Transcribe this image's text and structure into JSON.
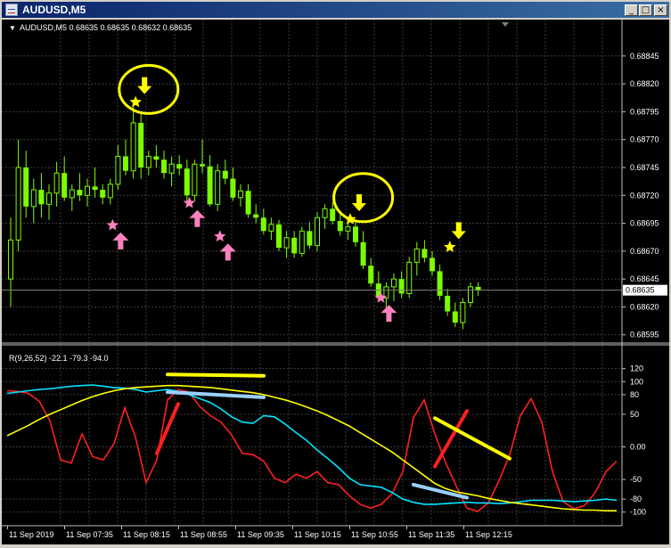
{
  "window": {
    "title": "AUDUSD,M5",
    "buttons": {
      "minimize": "_",
      "restore": "□",
      "close": "×"
    }
  },
  "colors": {
    "background": "#000000",
    "grid": "#3c3c3c",
    "candle": "#7cfc00",
    "fast_line": "#ff2020",
    "mid_line": "#00e5ff",
    "slow_line": "#ffff00",
    "sell_arrow": "#ffff00",
    "buy_arrow": "#ff80c0",
    "annotation_yellow": "#ffff00",
    "annotation_red": "#ff2020",
    "annotation_lightblue": "#9ad0ff"
  },
  "chart_data": [
    {
      "type": "candlestick",
      "symbol": "AUDUSD,M5",
      "header": "AUDUSD,M5  0.68635 0.68635 0.68632 0.68635",
      "y_ticks": [
        "0.68845",
        "0.68820",
        "0.68795",
        "0.68770",
        "0.68745",
        "0.68720",
        "0.68695",
        "0.68670",
        "0.68645",
        "0.68620",
        "0.68595"
      ],
      "ylim": [
        0.6859,
        0.6886
      ],
      "current_price": "0.68635",
      "grid": true,
      "candles": [
        [
          0.68645,
          0.687,
          0.6862,
          0.6868
        ],
        [
          0.6868,
          0.6877,
          0.6867,
          0.68745
        ],
        [
          0.68745,
          0.6876,
          0.687,
          0.6871
        ],
        [
          0.6871,
          0.68735,
          0.68695,
          0.68725
        ],
        [
          0.68725,
          0.6874,
          0.687,
          0.68712
        ],
        [
          0.68712,
          0.6873,
          0.68698,
          0.68722
        ],
        [
          0.68722,
          0.6875,
          0.6871,
          0.6874
        ],
        [
          0.6874,
          0.68755,
          0.68715,
          0.68718
        ],
        [
          0.68718,
          0.6873,
          0.68706,
          0.68725
        ],
        [
          0.68725,
          0.6874,
          0.68715,
          0.6872
        ],
        [
          0.6872,
          0.68735,
          0.6871,
          0.68728
        ],
        [
          0.68728,
          0.68745,
          0.68718,
          0.68725
        ],
        [
          0.68725,
          0.6873,
          0.68712,
          0.68718
        ],
        [
          0.68718,
          0.68735,
          0.68712,
          0.6873
        ],
        [
          0.6873,
          0.68765,
          0.68725,
          0.68755
        ],
        [
          0.68755,
          0.6877,
          0.68738,
          0.68742
        ],
        [
          0.68742,
          0.688,
          0.68735,
          0.68785
        ],
        [
          0.68785,
          0.68795,
          0.68735,
          0.68745
        ],
        [
          0.68745,
          0.6876,
          0.68738,
          0.68755
        ],
        [
          0.68755,
          0.68765,
          0.68745,
          0.68752
        ],
        [
          0.68752,
          0.6876,
          0.68735,
          0.6874
        ],
        [
          0.6874,
          0.68755,
          0.68728,
          0.68748
        ],
        [
          0.68748,
          0.68756,
          0.68738,
          0.68744
        ],
        [
          0.68744,
          0.68752,
          0.68715,
          0.6872
        ],
        [
          0.6872,
          0.68752,
          0.68715,
          0.68748
        ],
        [
          0.68748,
          0.6877,
          0.6874,
          0.68746
        ],
        [
          0.68746,
          0.68756,
          0.6871,
          0.68712
        ],
        [
          0.68712,
          0.68748,
          0.68706,
          0.68742
        ],
        [
          0.68742,
          0.68752,
          0.6873,
          0.68735
        ],
        [
          0.68735,
          0.68745,
          0.68715,
          0.68718
        ],
        [
          0.68718,
          0.6873,
          0.6871,
          0.68724
        ],
        [
          0.68724,
          0.6873,
          0.687,
          0.68703
        ],
        [
          0.68703,
          0.68712,
          0.68695,
          0.687
        ],
        [
          0.687,
          0.68708,
          0.68685,
          0.68688
        ],
        [
          0.68688,
          0.687,
          0.6868,
          0.68694
        ],
        [
          0.68694,
          0.68698,
          0.6867,
          0.68673
        ],
        [
          0.68673,
          0.68688,
          0.68664,
          0.68682
        ],
        [
          0.68682,
          0.68688,
          0.68664,
          0.68668
        ],
        [
          0.68668,
          0.68692,
          0.68665,
          0.68688
        ],
        [
          0.68688,
          0.68696,
          0.68672,
          0.68675
        ],
        [
          0.68675,
          0.68705,
          0.6867,
          0.687
        ],
        [
          0.687,
          0.68712,
          0.6869,
          0.68708
        ],
        [
          0.68708,
          0.68714,
          0.68694,
          0.68697
        ],
        [
          0.68697,
          0.68704,
          0.68684,
          0.68688
        ],
        [
          0.68688,
          0.68698,
          0.6868,
          0.68692
        ],
        [
          0.68692,
          0.68698,
          0.68674,
          0.68678
        ],
        [
          0.68678,
          0.68688,
          0.68654,
          0.68657
        ],
        [
          0.68657,
          0.68664,
          0.68638,
          0.68641
        ],
        [
          0.68641,
          0.68652,
          0.68625,
          0.68628
        ],
        [
          0.68628,
          0.68642,
          0.68618,
          0.68638
        ],
        [
          0.68638,
          0.6865,
          0.68625,
          0.68645
        ],
        [
          0.68645,
          0.68652,
          0.68628,
          0.68632
        ],
        [
          0.68632,
          0.68665,
          0.68628,
          0.6866
        ],
        [
          0.6866,
          0.68678,
          0.68648,
          0.68672
        ],
        [
          0.68672,
          0.6868,
          0.6866,
          0.68664
        ],
        [
          0.68664,
          0.6867,
          0.68648,
          0.68652
        ],
        [
          0.68652,
          0.68658,
          0.68626,
          0.6863
        ],
        [
          0.6863,
          0.68636,
          0.68612,
          0.68616
        ],
        [
          0.68616,
          0.68624,
          0.68602,
          0.68606
        ],
        [
          0.68606,
          0.68628,
          0.686,
          0.68624
        ],
        [
          0.68624,
          0.68642,
          0.6862,
          0.68638
        ],
        [
          0.68638,
          0.68642,
          0.6863,
          0.68635
        ]
      ],
      "x_ticks": [
        "11 Sep 2019",
        "11 Sep 07:35",
        "11 Sep 08:15",
        "11 Sep 08:55",
        "11 Sep 09:35",
        "11 Sep 10:15",
        "11 Sep 10:55",
        "11 Sep 11:35",
        "11 Sep 12:15"
      ],
      "sell_signals": [
        [
          17,
          0.6881
        ],
        [
          45,
          0.68705
        ],
        [
          58,
          0.6868
        ]
      ],
      "buy_signals": [
        [
          14,
          0.6869
        ],
        [
          24,
          0.6871
        ],
        [
          28,
          0.6868
        ],
        [
          49,
          0.68625
        ]
      ],
      "circles": [
        [
          18,
          0.68815
        ],
        [
          46,
          0.68718
        ]
      ]
    },
    {
      "type": "line",
      "label": "R(9,26,52) -22.1 -79.3 -94.0",
      "y_ticks": [
        "120",
        "100",
        "80",
        "50",
        "0.00",
        "-50",
        "-80",
        "-100"
      ],
      "ylim": [
        -110,
        125
      ],
      "series": [
        {
          "values": [
            86,
            85,
            82,
            70,
            40,
            -20,
            -25,
            20,
            -15,
            -20,
            5,
            60,
            15,
            -55,
            -20,
            72,
            88,
            84,
            62,
            48,
            38,
            18,
            -10,
            -12,
            -22,
            -48,
            -55,
            -42,
            -48,
            -38,
            -55,
            -58,
            -75,
            -88,
            -94,
            -88,
            -72,
            -38,
            45,
            72,
            20,
            -24,
            -60,
            -94,
            -99,
            -86,
            -52,
            -12,
            48,
            74,
            38,
            -38,
            -84,
            -95,
            -90,
            -70,
            -38,
            -22
          ]
        },
        {
          "values": [
            82,
            84,
            86,
            88,
            89,
            91,
            93,
            94,
            95,
            93,
            91,
            90,
            88,
            84,
            86,
            88,
            85,
            80,
            74,
            68,
            58,
            46,
            38,
            36,
            48,
            46,
            35,
            22,
            10,
            -5,
            -18,
            -32,
            -48,
            -58,
            -60,
            -62,
            -70,
            -80,
            -85,
            -88,
            -88,
            -87,
            -86,
            -85,
            -86,
            -86,
            -87,
            -86,
            -84,
            -82,
            -82,
            -82,
            -83,
            -84,
            -83,
            -82,
            -80,
            -82
          ]
        },
        {
          "values": [
            17,
            25,
            33,
            42,
            50,
            57,
            64,
            71,
            77,
            82,
            86,
            89,
            91,
            92,
            93,
            94,
            94,
            93,
            92,
            91,
            89,
            87,
            85,
            83,
            80,
            76,
            72,
            67,
            61,
            55,
            48,
            40,
            32,
            22,
            12,
            2,
            -8,
            -20,
            -32,
            -44,
            -56,
            -64,
            -69,
            -72,
            -75,
            -79,
            -82,
            -85,
            -87,
            -89,
            -91,
            -93,
            -95,
            -96,
            -97,
            -97,
            -98,
            -98
          ]
        }
      ],
      "annotations": [
        {
          "color": "#ffff00",
          "from": [
            15,
            111
          ],
          "to": [
            24,
            109
          ]
        },
        {
          "color": "#9ad0ff",
          "from": [
            15,
            84
          ],
          "to": [
            24,
            76
          ]
        },
        {
          "color": "#ff2020",
          "from": [
            14,
            -10
          ],
          "to": [
            16,
            66
          ]
        },
        {
          "color": "#ff2020",
          "from": [
            40,
            -30
          ],
          "to": [
            43,
            55
          ]
        },
        {
          "color": "#ffff00",
          "from": [
            40,
            44
          ],
          "to": [
            47,
            -18
          ]
        },
        {
          "color": "#9ad0ff",
          "from": [
            38,
            -58
          ],
          "to": [
            43,
            -78
          ]
        }
      ]
    }
  ]
}
